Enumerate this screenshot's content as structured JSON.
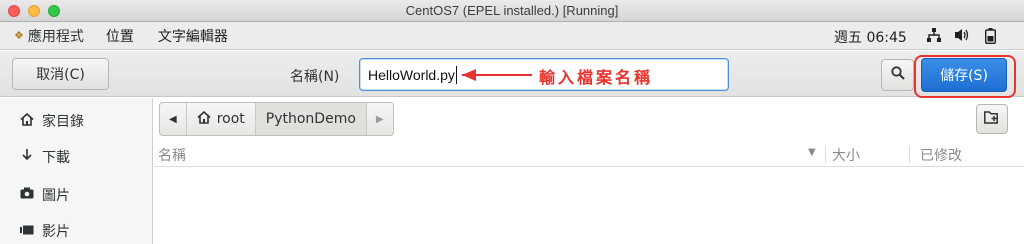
{
  "window": {
    "title": "CentOS7 (EPEL installed.) [Running]"
  },
  "topbar": {
    "apps_label": "應用程式",
    "places_label": "位置",
    "app_name": "文字編輯器",
    "clock": "週五 06:45",
    "icons": [
      "network-icon",
      "volume-icon",
      "battery-icon"
    ]
  },
  "header": {
    "cancel_label": "取消(C)",
    "name_label": "名稱(N)",
    "filename_value": "HelloWorld.py",
    "annotation": "輸入檔案名稱",
    "save_label": "儲存(S)",
    "accent_color": "#1d6fd3",
    "annotation_color": "#e8322e"
  },
  "sidebar": {
    "items": [
      {
        "icon": "home-icon",
        "label": "家目錄"
      },
      {
        "icon": "download-icon",
        "label": "下載"
      },
      {
        "icon": "camera-icon",
        "label": "圖片"
      },
      {
        "icon": "video-icon",
        "label": "影片"
      }
    ]
  },
  "pathbar": {
    "crumbs": [
      "root",
      "PythonDemo"
    ]
  },
  "list": {
    "columns": [
      "名稱",
      "大小",
      "已修改"
    ]
  }
}
